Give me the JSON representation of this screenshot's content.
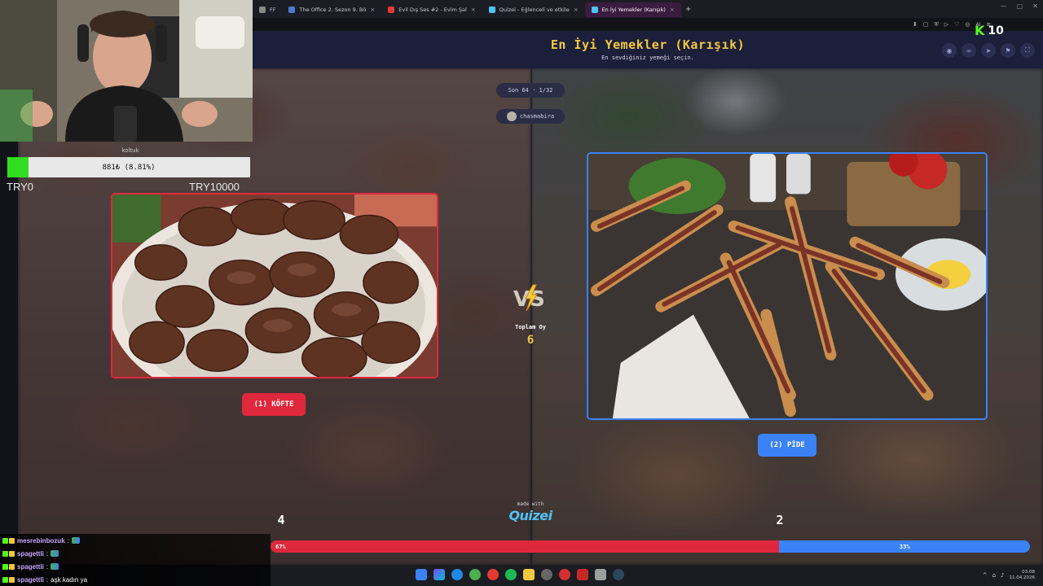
{
  "browser": {
    "tabs": [
      {
        "label": "FF",
        "active": false,
        "color": "#888888"
      },
      {
        "label": "The Office 2. Sezon 9. Bö",
        "active": false,
        "color": "#4a7bd0"
      },
      {
        "label": "Evil Dış Ses #2 - Evim Şal",
        "active": false,
        "color": "#e53935"
      },
      {
        "label": "Quizei - Eğlenceli ve etkile",
        "active": false,
        "color": "#4fc3f7"
      },
      {
        "label": "En İyi Yemekler (Karışık)",
        "active": true,
        "color": "#4fc3f7"
      }
    ],
    "new_tab": "+",
    "ai_label": "AI"
  },
  "quiz": {
    "title": "En İyi Yemekler (Karışık)",
    "subtitle": "En sevdiğiniz yemeği seçin.",
    "round": "Son 64 · 1/32",
    "username": "chasmabira",
    "total_label": "Toplam Oy",
    "total_votes": "6",
    "left": {
      "label": "(1) KÖFTE",
      "votes": "4",
      "percent_label": "67%",
      "percent": 0.67,
      "color": "#e0283c",
      "image": "köfte-photo"
    },
    "right": {
      "label": "(2) PİDE",
      "votes": "2",
      "percent_label": "33%",
      "percent": 0.33,
      "color": "#3b82f6",
      "image": "pide-photo"
    },
    "made_with": "made with",
    "brand": "Quizei"
  },
  "donation": {
    "label": "koltuk",
    "progress_text": "881₺ (8.81%)",
    "progress": 0.0881,
    "min": "TRY0",
    "max": "TRY10000"
  },
  "kick": {
    "viewers": "10"
  },
  "chat": [
    {
      "user": "mesrebinbozuk",
      "message": ""
    },
    {
      "user": "spagettli",
      "message": ""
    },
    {
      "user": "spagettli",
      "message": ""
    },
    {
      "user": "spagettli",
      "message": "aşk kadın ya"
    }
  ],
  "taskbar": {
    "time": "03:08",
    "date": "11.04.2026"
  }
}
